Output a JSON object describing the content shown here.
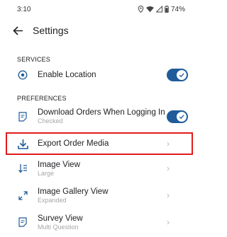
{
  "status": {
    "time": "3:10",
    "battery": "74%"
  },
  "appbar": {
    "title": "Settings"
  },
  "sections": {
    "services": "SERVICES",
    "preferences": "PREFERENCES"
  },
  "items": {
    "enable_location": {
      "label": "Enable Location",
      "enabled": true
    },
    "download_orders": {
      "label": "Download Orders When Logging In",
      "sub": "Checked",
      "enabled": true
    },
    "export_media": {
      "label": "Export Order Media"
    },
    "image_view": {
      "label": "Image View",
      "sub": "Large"
    },
    "gallery_view": {
      "label": "Image Gallery View",
      "sub": "Expanded"
    },
    "survey_view": {
      "label": "Survey View",
      "sub": "Multi Question"
    }
  },
  "chevron": "›",
  "colors": {
    "accent": "#1f5c99",
    "highlight": "#e01b1b"
  }
}
